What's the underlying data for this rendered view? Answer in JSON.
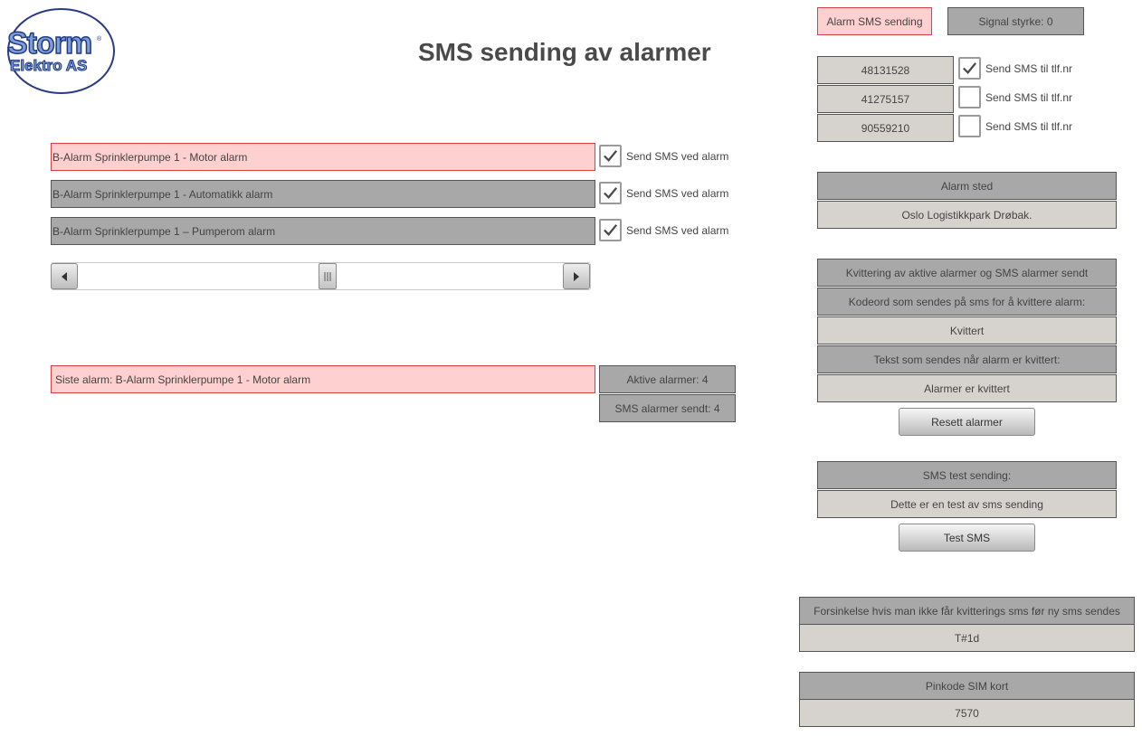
{
  "logo": {
    "line1": "Storm",
    "line2": "Elektro AS",
    "reg": "®"
  },
  "page_title": "SMS sending av alarmer",
  "status": {
    "alarm_sms_sending": "Alarm SMS sending",
    "signal_strength": "Signal styrke: 0"
  },
  "phones": [
    {
      "number": "48131528",
      "label": "Send SMS til tlf.nr",
      "checked": true
    },
    {
      "number": "41275157",
      "label": "Send SMS til tlf.nr",
      "checked": false
    },
    {
      "number": "90559210",
      "label": "Send SMS til tlf.nr",
      "checked": false
    }
  ],
  "alarms": [
    {
      "text": "B-Alarm Sprinklerpumpe 1 - Motor alarm",
      "active": true,
      "label": "Send SMS ved alarm",
      "checked": true
    },
    {
      "text": "B-Alarm Sprinklerpumpe 1 - Automatikk alarm",
      "active": false,
      "label": "Send SMS ved alarm",
      "checked": true
    },
    {
      "text": "B-Alarm Sprinklerpumpe 1 – Pumperom alarm",
      "active": false,
      "label": "Send SMS ved alarm",
      "checked": true
    }
  ],
  "last_alarm": "Siste alarm: B-Alarm Sprinklerpumpe 1 - Motor alarm",
  "counters": {
    "active_alarms": "Aktive alarmer: 4",
    "sms_sent": "SMS alarmer sendt: 4"
  },
  "location": {
    "header": "Alarm sted",
    "value": "Oslo Logistikkpark Drøbak."
  },
  "acknowledge": {
    "header": "Kvittering av aktive alarmer og SMS alarmer sendt",
    "code_label": "Kodeord som sendes på sms for å kvittere alarm:",
    "code_value": "Kvittert",
    "text_label": "Tekst som sendes når alarm er kvittert:",
    "text_value": "Alarmer er kvittert",
    "reset_button": "Resett alarmer"
  },
  "sms_test": {
    "header": "SMS test sending:",
    "message": "Dette er en test av sms sending",
    "button": "Test SMS"
  },
  "delay": {
    "header": "Forsinkelse hvis man ikke får kvitterings sms før ny sms sendes",
    "value": "T#1d"
  },
  "pin": {
    "header": "Pinkode SIM kort",
    "value": "7570"
  },
  "colors": {
    "alarm_bg": "#ffd0d0",
    "alarm_border": "#d84040",
    "dark_box": "#a8a8a8",
    "light_box": "#d6d3ce"
  }
}
